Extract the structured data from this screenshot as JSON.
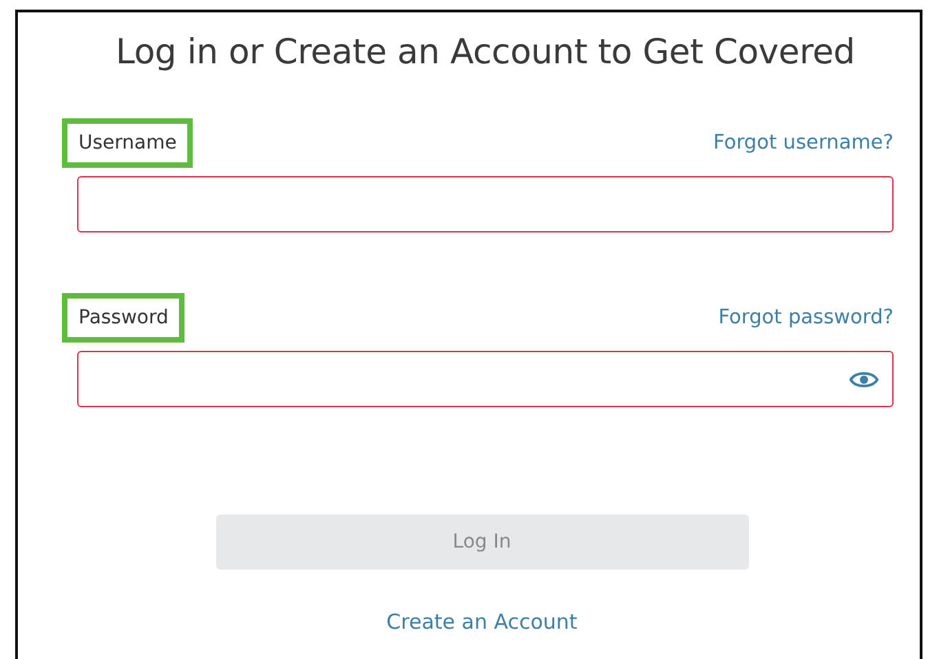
{
  "title": "Log in or Create an Account to Get Covered",
  "fields": [
    {
      "kind": "text",
      "label": "Username",
      "highlighted": true,
      "invalid": true,
      "link": "Forgot username?"
    },
    {
      "kind": "password",
      "label": "Password",
      "highlighted": true,
      "invalid": true,
      "link": "Forgot password?"
    }
  ],
  "login_button": {
    "label": "Log In",
    "disabled": true
  },
  "create_link": "Create an Account"
}
